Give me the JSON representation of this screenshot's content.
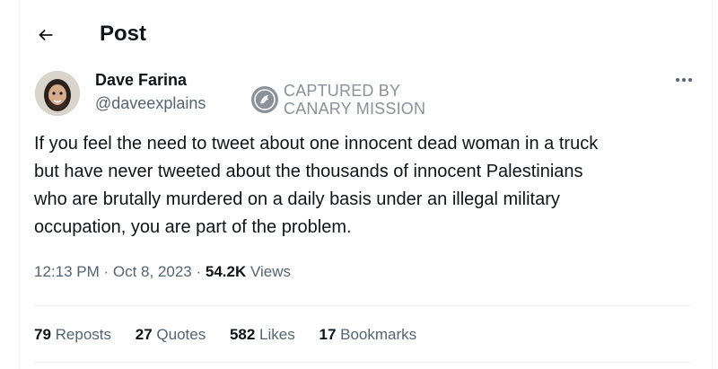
{
  "header": {
    "title": "Post"
  },
  "author": {
    "name": "Dave Farina",
    "handle": "@daveexplains"
  },
  "watermark": {
    "line1": "CAPTURED BY",
    "line2": "CANARY MISSION"
  },
  "tweet": {
    "lines": [
      "If you feel the need to tweet about one innocent dead woman in a truck",
      "but have never tweeted about the thousands of innocent Palestinians",
      "who are brutally murdered on a daily basis under an illegal military",
      "occupation, you are part of the problem."
    ]
  },
  "meta": {
    "time": "12:13 PM",
    "sep1": " · ",
    "date": "Oct 8, 2023",
    "sep2": " · ",
    "views_count": "54.2K",
    "views_label": " Views"
  },
  "stats": {
    "reposts": {
      "count": "79",
      "label": " Reposts"
    },
    "quotes": {
      "count": "27",
      "label": " Quotes"
    },
    "likes": {
      "count": "582",
      "label": " Likes"
    },
    "bookmarks": {
      "count": "17",
      "label": " Bookmarks"
    }
  },
  "icons": {
    "back": "arrow-left-icon",
    "more": "more-horizontal-icon",
    "seal": "canary-mission-seal"
  },
  "colors": {
    "text": "#0f1419",
    "secondary": "#536471",
    "border": "#eff3f4",
    "watermark": "#8a9198"
  }
}
